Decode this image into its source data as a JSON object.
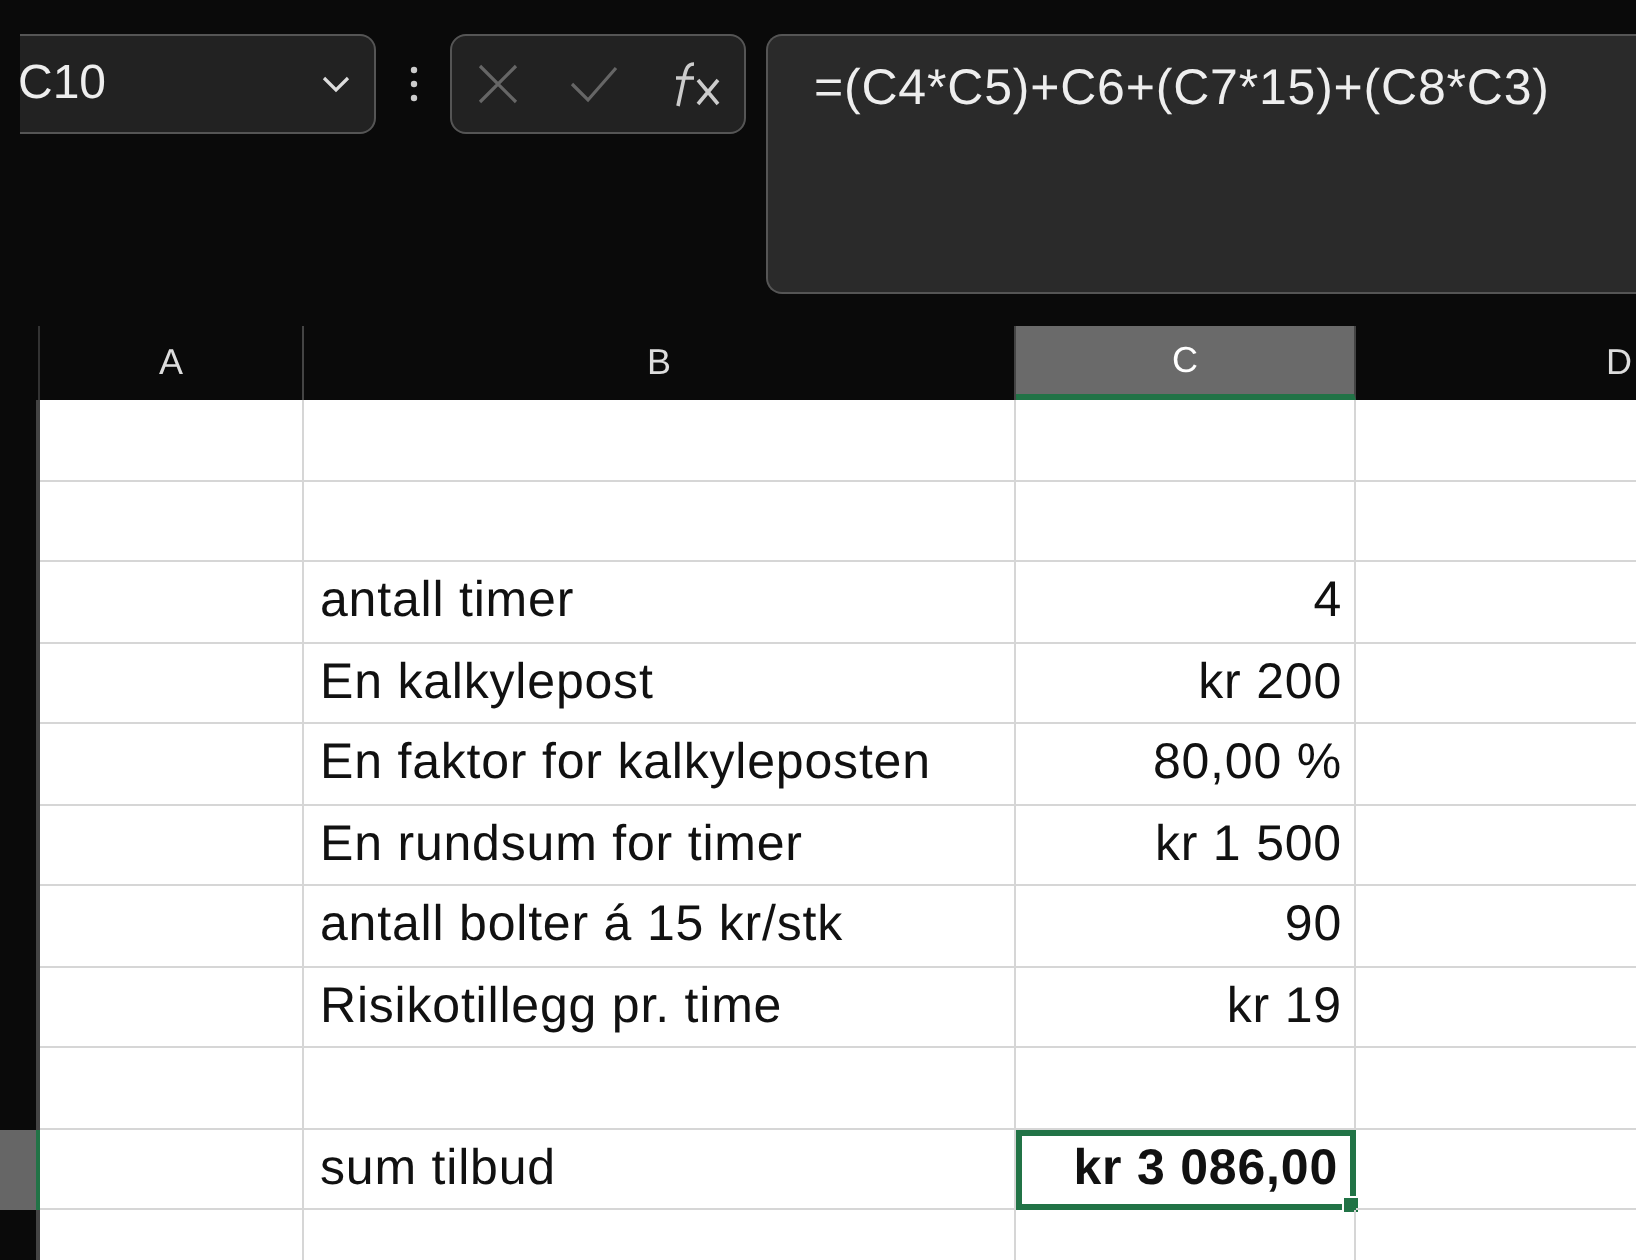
{
  "name_box": {
    "value": "C10"
  },
  "formula_bar": {
    "formula": "=(C4*C5)+C6+(C7*15)+(C8*C3)"
  },
  "columns": [
    {
      "label": "A",
      "selected": false
    },
    {
      "label": "B",
      "selected": false
    },
    {
      "label": "C",
      "selected": true
    },
    {
      "label": "D",
      "selected": false
    }
  ],
  "rows": [
    {
      "selected": false
    },
    {
      "selected": false
    },
    {
      "label": "antall timer",
      "value": "4",
      "selected": false
    },
    {
      "label": "En kalkylepost",
      "value": "kr 200",
      "selected": false
    },
    {
      "label": "En faktor for kalkyleposten",
      "value": "80,00 %",
      "selected": false
    },
    {
      "label": "En rundsum for timer",
      "value": "kr 1 500",
      "selected": false
    },
    {
      "label": "antall bolter á 15 kr/stk",
      "value": "90",
      "selected": false
    },
    {
      "label": "Risikotillegg pr. time",
      "value": "kr 19",
      "selected": false
    },
    {
      "selected": false
    },
    {
      "label": "sum tilbud",
      "value": "kr 3 086,00",
      "selected": true
    },
    {
      "selected": false
    }
  ]
}
